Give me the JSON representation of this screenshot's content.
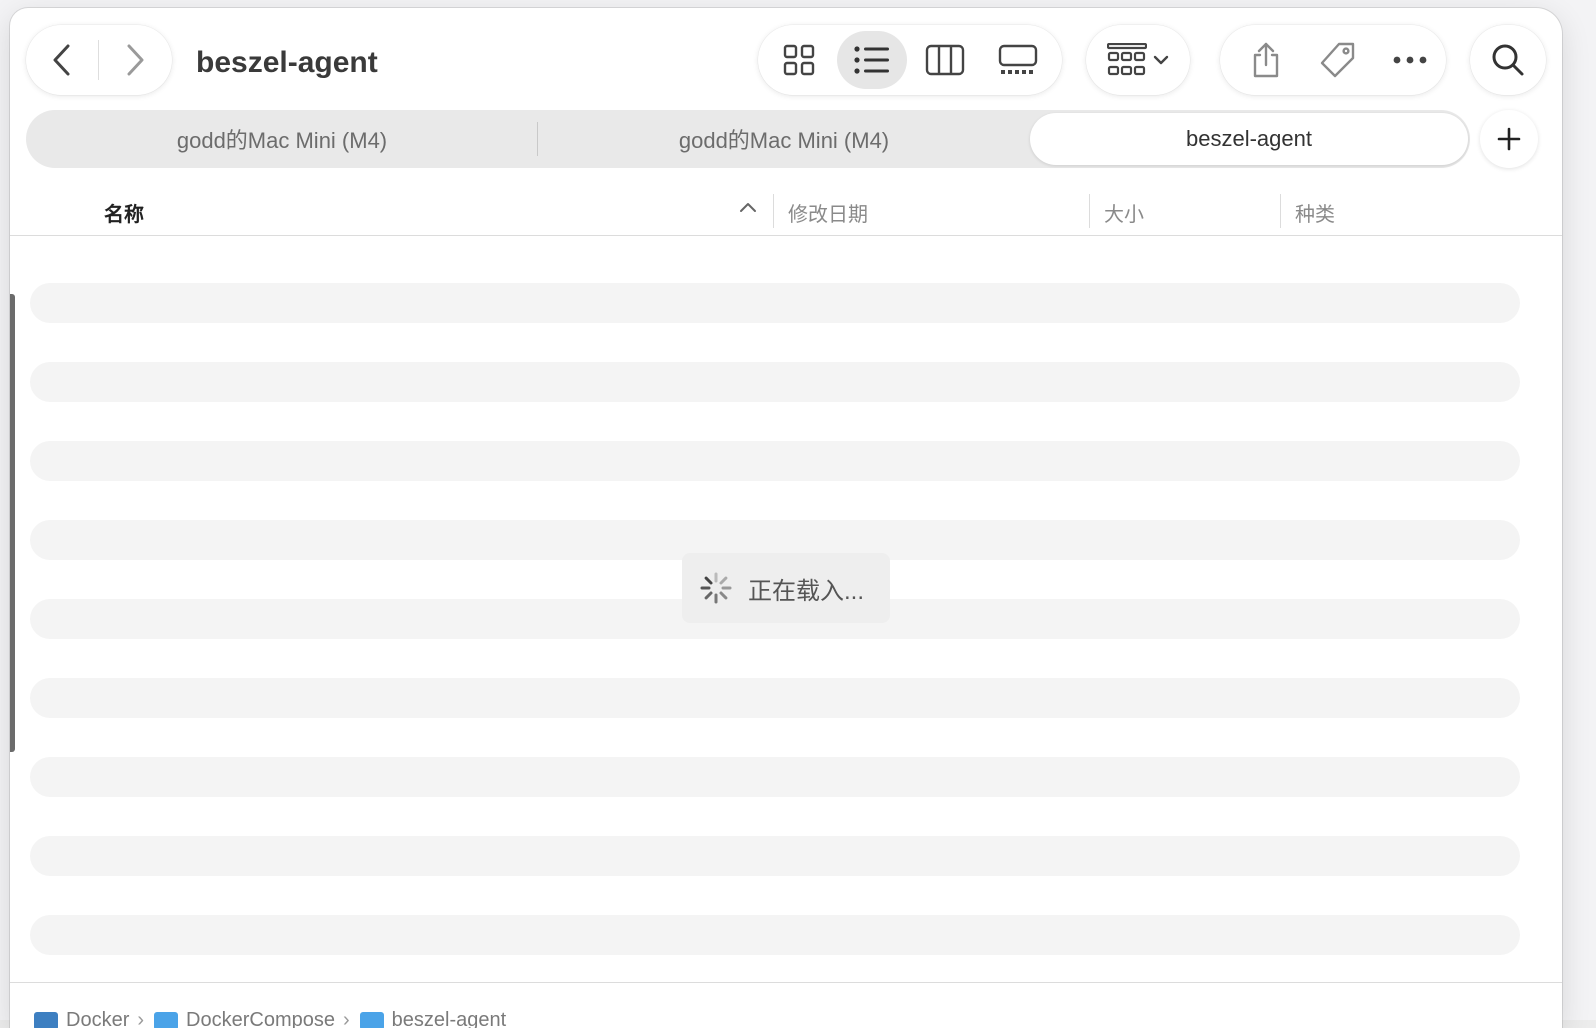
{
  "window": {
    "title": "beszel-agent"
  },
  "toolbar": {
    "back_icon": "chevron-left-icon",
    "forward_icon": "chevron-right-icon",
    "view_modes": [
      "icon-view",
      "list-view",
      "column-view",
      "gallery-view"
    ],
    "active_view": "list-view",
    "group_icon": "group-grid-icon",
    "share_icon": "share-icon",
    "tag_icon": "tag-icon",
    "more_icon": "ellipsis-icon",
    "search_icon": "search-icon"
  },
  "tabs": [
    {
      "label": "godd的Mac Mini (M4)",
      "active": false
    },
    {
      "label": "godd的Mac Mini (M4)",
      "active": false
    },
    {
      "label": "beszel-agent",
      "active": true
    }
  ],
  "add_tab_label": "+",
  "columns": {
    "name": "名称",
    "modified": "修改日期",
    "size": "大小",
    "kind": "种类"
  },
  "loading": {
    "text": "正在载入..."
  },
  "path": [
    {
      "label": "Docker",
      "color": "#3d7fc1"
    },
    {
      "label": "DockerCompose",
      "color": "#4aa3e8"
    },
    {
      "label": "beszel-agent",
      "color": "#4aa3e8"
    }
  ],
  "colors": {
    "accent": "#4aa3e8",
    "skeleton": "#f4f4f4"
  }
}
